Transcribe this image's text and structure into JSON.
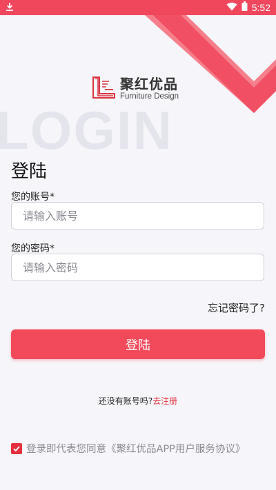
{
  "status_bar": {
    "time": "5:52",
    "bg_color": "#f0475d"
  },
  "brand": {
    "name_cn": "聚红优品",
    "name_en": "Furniture Design",
    "logo_letter_color": "#d8343f"
  },
  "watermark": "LOGIN",
  "title": "登陆",
  "form": {
    "account_label": "您的账号*",
    "account_placeholder": "请输入账号",
    "account_value": "",
    "password_label": "您的密码*",
    "password_placeholder": "请输入密码",
    "password_value": ""
  },
  "forgot_password": "忘记密码了?",
  "login_button": "登陆",
  "register": {
    "prompt": "还没有账号吗?",
    "link": "去注册"
  },
  "agreement": {
    "checked": true,
    "text": "登录即代表您同意《聚红优品APP用户服务协议》"
  },
  "colors": {
    "accent": "#f24a5a",
    "link": "#e5303f",
    "background": "#f6f6fa"
  }
}
